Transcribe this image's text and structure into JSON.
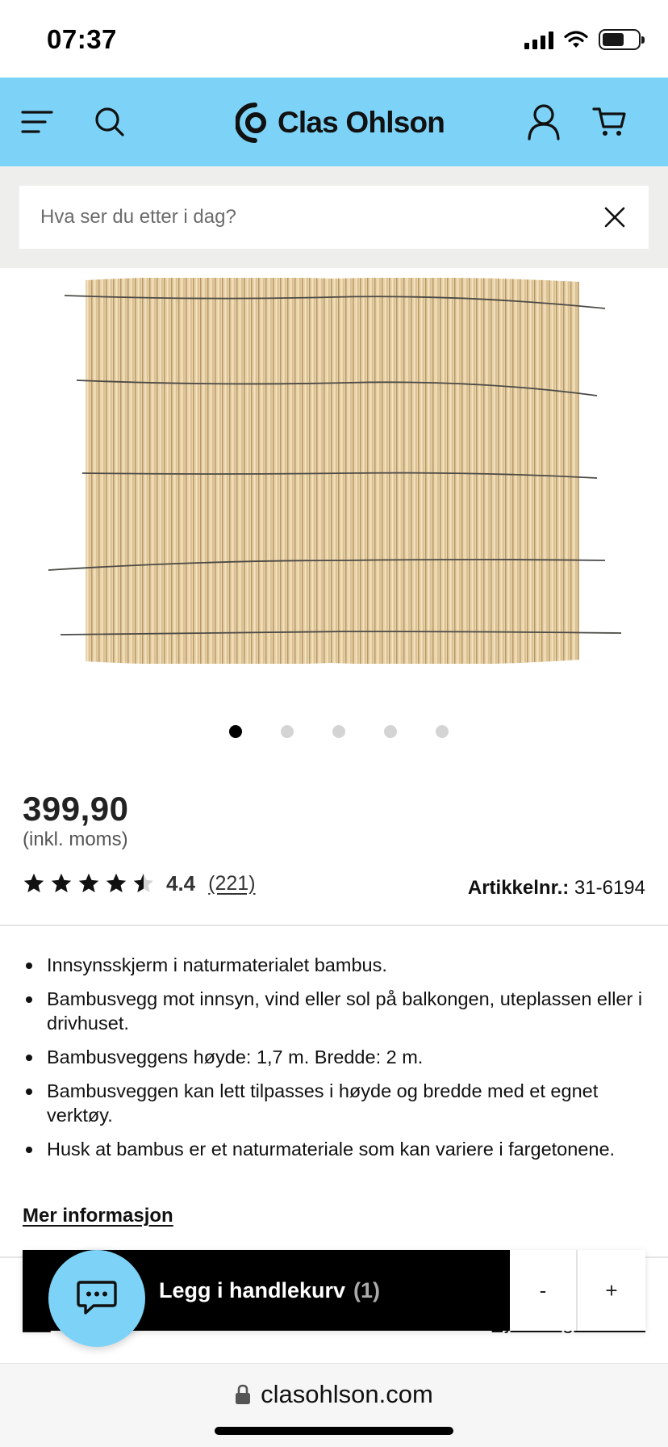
{
  "status_bar": {
    "time": "07:37"
  },
  "header": {
    "brand": "Clas Ohlson"
  },
  "search": {
    "placeholder": "Hva ser du etter i dag?"
  },
  "gallery": {
    "dot_count": 5,
    "active_index": 0
  },
  "product": {
    "price": "399,90",
    "price_note": "(inkl. moms)",
    "rating_stars": 4.4,
    "rating_value": "4.4",
    "rating_count": "(221)",
    "article_label": "Artikkelnr.:",
    "article_number": "31-6194",
    "features": [
      "Innsynsskjerm i naturmaterialet bambus.",
      "Bambusvegg mot innsyn, vind eller sol på balkongen, uteplassen eller i drivhuset.",
      "Bambusveggens høyde: 1,7 m. Bredde: 2 m.",
      "Bambusveggen kan lett tilpasses i høyde og bredde med et egnet verktøy.",
      "Husk at bambus er et naturmateriale som kan variere i fargetonene."
    ],
    "more_info": "Mer informasjon"
  },
  "partial_row": {
    "left": "Vel",
    "right": "Sjekk lagerstatus"
  },
  "cart_bar": {
    "add_label": "Legg i handlekurv",
    "quantity": "(1)",
    "minus": "-",
    "plus": "+"
  },
  "browser": {
    "url": "clasohlson.com"
  },
  "colors": {
    "header_bg": "#7dd3f7",
    "search_bg": "#eeeeec",
    "cart_button": "#000000"
  }
}
